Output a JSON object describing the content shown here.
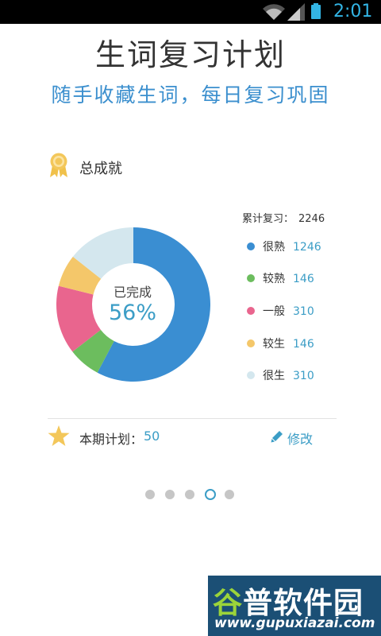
{
  "status_bar": {
    "time": "2:01"
  },
  "header": {
    "title": "生词复习计划",
    "subtitle": "随手收藏生词，每日复习巩固"
  },
  "achievement": {
    "label": "总成就"
  },
  "center": {
    "label": "已完成",
    "value": "56%"
  },
  "total": {
    "label": "累计复习：",
    "value": "2246"
  },
  "plan": {
    "label": "本期计划：",
    "value": "50",
    "edit_label": "修改"
  },
  "pager": {
    "count": 5,
    "active": 3
  },
  "watermark": {
    "brand": "谷普软件园",
    "url": "www.gupuxiazai.com"
  },
  "chart_data": {
    "type": "pie",
    "title": "",
    "center_label": "已完成",
    "center_value": "56%",
    "slices": [
      {
        "name": "很熟",
        "value": 1246,
        "color": "#3a8ed2"
      },
      {
        "name": "较熟",
        "value": 146,
        "color": "#6cbd5e"
      },
      {
        "name": "一般",
        "value": 310,
        "color": "#e9658e"
      },
      {
        "name": "较生",
        "value": 146,
        "color": "#f4c76a"
      },
      {
        "name": "很生",
        "value": 310,
        "color": "#d4e7ee"
      }
    ]
  }
}
